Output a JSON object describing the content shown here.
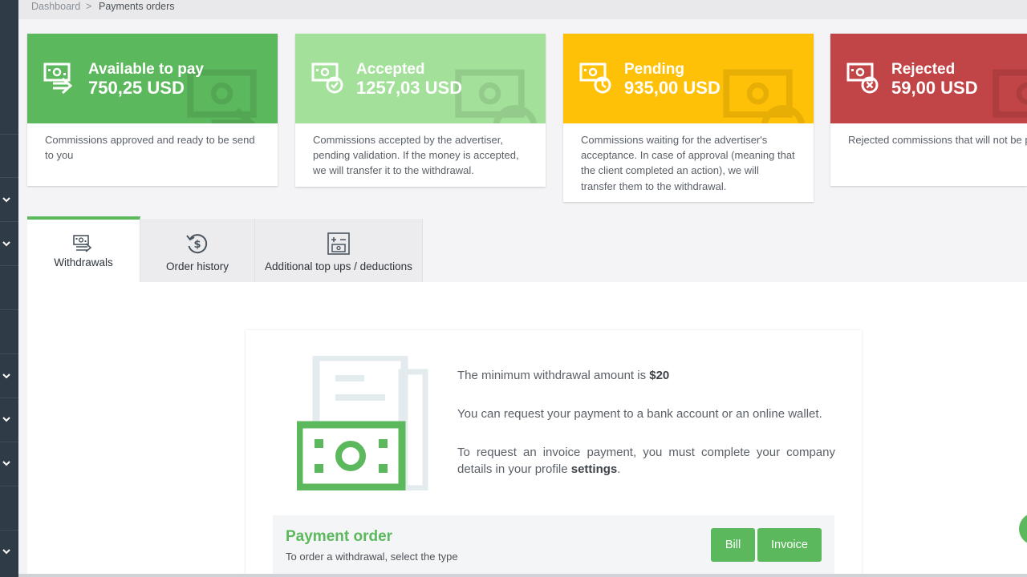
{
  "breadcrumb": {
    "home": "Dashboard",
    "separator": ">",
    "current": "Payments orders"
  },
  "cards": [
    {
      "title": "Available to pay",
      "amount": "750,25 USD",
      "description": "Commissions approved and ready to be send to you",
      "color": "#5cb85c",
      "icon": "money-send-icon"
    },
    {
      "title": "Accepted",
      "amount": "1257,03 USD",
      "description": "Commissions accepted by the advertiser, pending validation. If the money is accepted, we will transfer it to the withdrawal.",
      "color": "#a3e09a",
      "icon": "money-check-icon"
    },
    {
      "title": "Pending",
      "amount": "935,00 USD",
      "description": "Commissions waiting for the advertiser's acceptance. In case of approval (meaning that the client completed an action), we will transfer them to the withdrawal.",
      "color": "#ffc107",
      "icon": "money-clock-icon"
    },
    {
      "title": "Rejected",
      "amount": "59,00 USD",
      "description": "Rejected commissions that will not be p",
      "color": "#c14446",
      "icon": "money-cancel-icon"
    }
  ],
  "tabs": [
    {
      "label": "Withdrawals",
      "icon": "withdrawals-icon",
      "active": true
    },
    {
      "label": "Order history",
      "icon": "history-dollar-icon",
      "active": false
    },
    {
      "label": "Additional top ups / deductions",
      "icon": "calculator-money-icon",
      "active": false
    }
  ],
  "info": {
    "min_prefix": "The minimum withdrawal amount is ",
    "min_amount": "$20",
    "line2": "You can request your payment to a bank account or an online wallet.",
    "line3_prefix": "To request an invoice payment, you must complete your company details in your profile ",
    "line3_link": "settings",
    "line3_suffix": "."
  },
  "payment_order": {
    "title": "Payment order",
    "subtitle": "To order a withdrawal, select the type",
    "bill_label": "Bill",
    "invoice_label": "Invoice"
  },
  "accent": "#5cb85c"
}
